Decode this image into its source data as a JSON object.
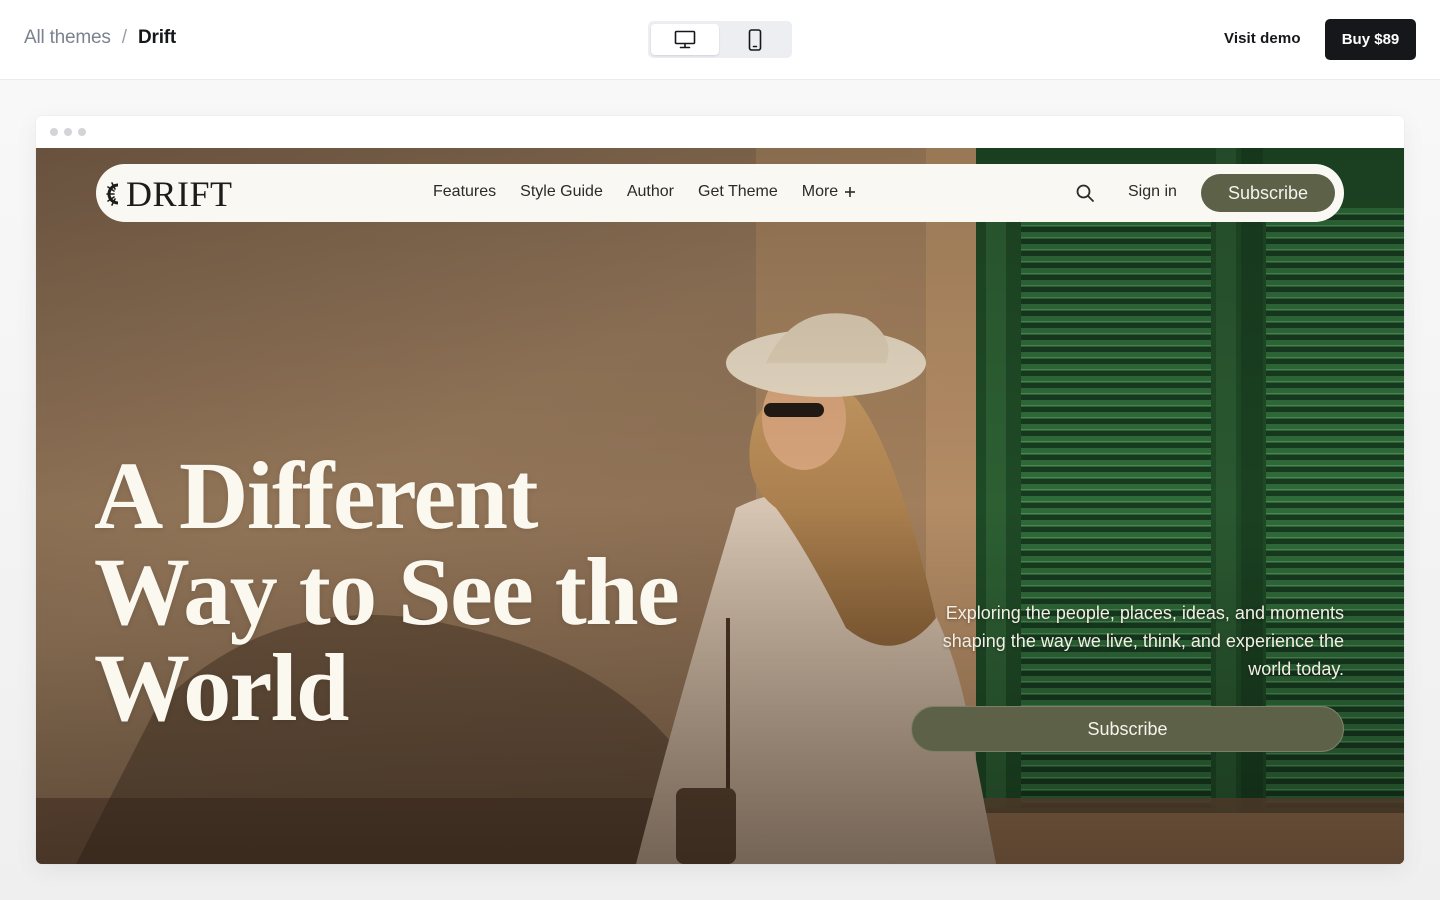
{
  "breadcrumb": {
    "parent": "All themes",
    "separator": "/",
    "current": "Drift"
  },
  "device_switch": {
    "options": [
      "desktop",
      "mobile"
    ],
    "active": "desktop"
  },
  "header_actions": {
    "visit_demo": "Visit demo",
    "buy": "Buy $89"
  },
  "site": {
    "logo": "DRIFT",
    "nav": [
      {
        "label": "Features"
      },
      {
        "label": "Style Guide"
      },
      {
        "label": "Author"
      },
      {
        "label": "Get Theme"
      },
      {
        "label": "More",
        "icon": "plus-icon"
      }
    ],
    "search_icon": "search-icon",
    "sign_in": "Sign in",
    "subscribe": "Subscribe"
  },
  "hero": {
    "headline_lines": [
      "A Different",
      "Way to See the",
      "World"
    ],
    "tagline": "Exploring the people, places, ideas, and moments shaping the way we live, think, and experience the world today.",
    "subscribe": "Subscribe"
  },
  "colors": {
    "accent": "#5d6148",
    "nav_bg": "#faf8f3",
    "dark_button": "#15171a",
    "wall": "#8f7457",
    "shutter": "#2d5f33"
  }
}
